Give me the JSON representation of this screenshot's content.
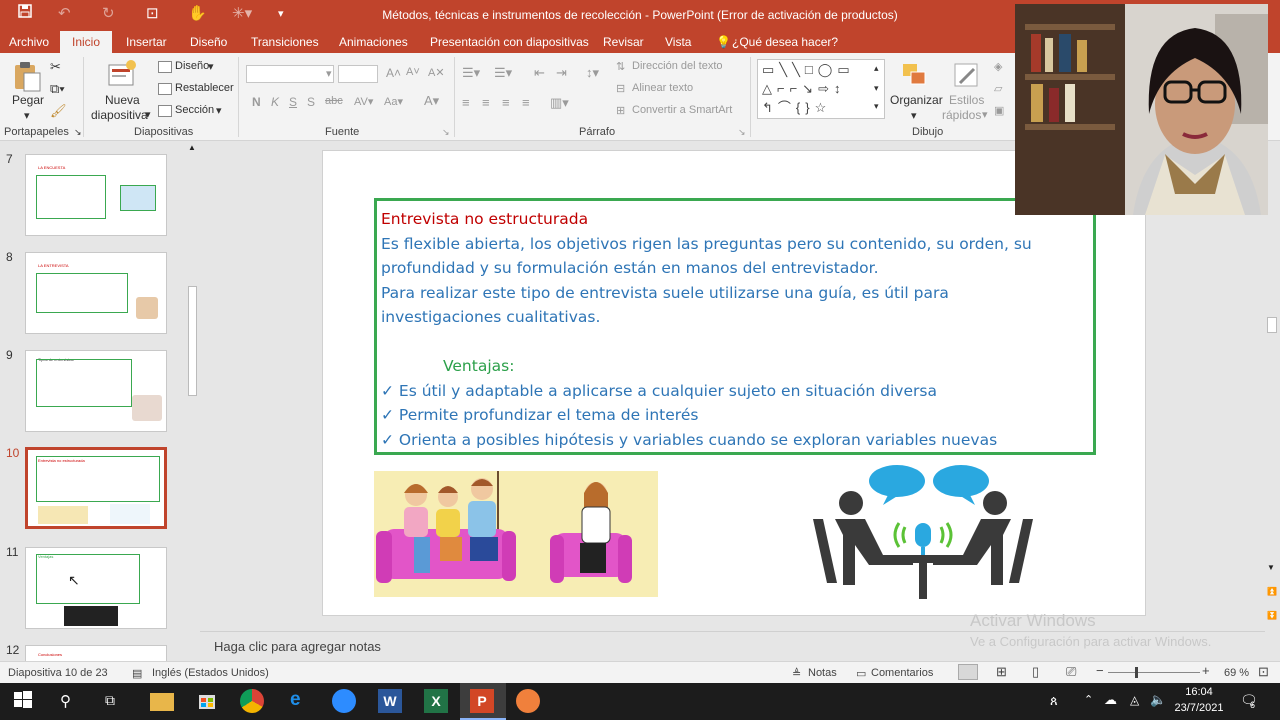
{
  "window": {
    "title": "Métodos, técnicas e instrumentos de recolección - PowerPoint (Error de activación de productos)"
  },
  "ribbon_tabs": [
    "Archivo",
    "Inicio",
    "Insertar",
    "Diseño",
    "Transiciones",
    "Animaciones",
    "Presentación con diapositivas",
    "Revisar",
    "Vista"
  ],
  "tell_me": "¿Qué desea hacer?",
  "ribbon": {
    "clipboard": {
      "paste": "Pegar",
      "group": "Portapapeles"
    },
    "slides": {
      "new_slide_1": "Nueva",
      "new_slide_2": "diapositiva",
      "layout": "Diseño",
      "reset": "Restablecer",
      "section": "Sección",
      "group": "Diapositivas"
    },
    "font": {
      "group": "Fuente",
      "bold": "N",
      "italic": "K",
      "underline": "S",
      "strike": "S",
      "shadow": "abc"
    },
    "paragraph": {
      "text_direction": "Dirección del texto",
      "align_text": "Alinear texto",
      "smartart": "Convertir a SmartArt",
      "group": "Párrafo"
    },
    "drawing": {
      "arrange_1": "Organizar",
      "quick_styles_1": "Estilos",
      "quick_styles_2": "rápidos",
      "group": "Dibujo"
    }
  },
  "thumbnails": [
    {
      "num": "7",
      "title": "LA ENCUESTA",
      "selected": false
    },
    {
      "num": "8",
      "title": "LA ENTREVISTA",
      "selected": false
    },
    {
      "num": "9",
      "title": "Tipos de entrevistas",
      "selected": false
    },
    {
      "num": "10",
      "title": "Entrevista no estructurada",
      "selected": true
    },
    {
      "num": "11",
      "title": "Ventajas",
      "selected": false
    },
    {
      "num": "12",
      "title": "Conclusiones",
      "selected": false
    }
  ],
  "slide": {
    "heading": "Entrevista no estructurada",
    "para1_line1": "Es flexible abierta,  los objetivos rigen las preguntas pero su contenido, su orden, su",
    "para1_line2": "profundidad y su formulación están en manos del entrevistador.",
    "para2_line1": "Para realizar este tipo de entrevista suele utilizarse una guía, es útil para",
    "para2_line2": "investigaciones cualitativas.",
    "advantages_title": "Ventajas:",
    "advantages": [
      "Es útil y adaptable a aplicarse a cualquier sujeto en situación diversa",
      "Permite profundizar el tema de interés",
      "Orienta a posibles hipótesis y variables cuando se exploran variables nuevas"
    ]
  },
  "notes_placeholder": "Haga clic para agregar notas",
  "watermark": {
    "line1": "Activar Windows",
    "line2": "Ve a Configuración para activar Windows."
  },
  "status": {
    "slide_info": "Diapositiva 10 de 23",
    "language": "Inglés (Estados Unidos)",
    "notes": "Notas",
    "comments": "Comentarios",
    "zoom": "69 %"
  },
  "taskbar": {
    "time": "16:04",
    "date": "23/7/2021",
    "notifications": "6"
  },
  "colors": {
    "accent": "#c0442c",
    "heading": "#c00000",
    "body": "#2e75b6",
    "ventajas": "#2ca04a",
    "border": "#3aa850"
  }
}
